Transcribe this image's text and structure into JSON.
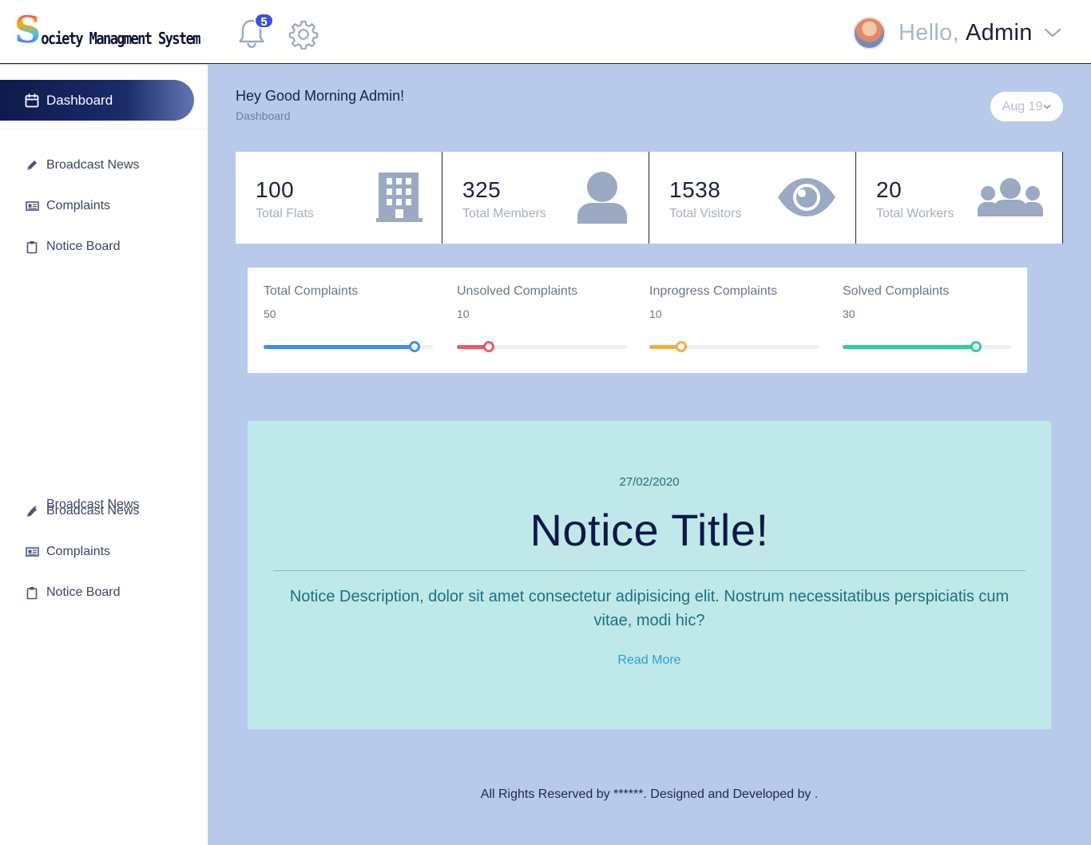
{
  "brand": {
    "initial": "S",
    "rest": "ociety Managment System"
  },
  "header": {
    "notification_count": "5",
    "greeting_prefix": "Hello,",
    "user_name": "Admin"
  },
  "sidebar": {
    "dashboard_label": "Dashboard",
    "group1": [
      {
        "label": "Broadcast News",
        "icon": "pencil-icon"
      },
      {
        "label": "Complaints",
        "icon": "newspaper-icon"
      },
      {
        "label": "Notice Board",
        "icon": "clipboard-icon"
      }
    ],
    "group2": [
      {
        "label": "Broadcast News",
        "icon": "pencil-icon"
      },
      {
        "label": "Complaints",
        "icon": "newspaper-icon"
      },
      {
        "label": "Notice Board",
        "icon": "clipboard-icon"
      }
    ]
  },
  "page": {
    "greeting": "Hey Good Morning Admin!",
    "breadcrumb": "Dashboard",
    "date_filter": "Aug 19"
  },
  "stats": [
    {
      "value": "100",
      "label": "Total Flats",
      "icon": "building-icon"
    },
    {
      "value": "325",
      "label": "Total Members",
      "icon": "user-icon"
    },
    {
      "value": "1538",
      "label": "Total Visitors",
      "icon": "eye-icon"
    },
    {
      "value": "20",
      "label": "Total Workers",
      "icon": "users-icon"
    }
  ],
  "complaints": [
    {
      "title": "Total Complaints",
      "value": "50",
      "progress": 0.89,
      "color": "#3d8ef0"
    },
    {
      "title": "Unsolved Complaints",
      "value": "10",
      "progress": 0.19,
      "color": "#f05667"
    },
    {
      "title": "Inprogress Complaints",
      "value": "10",
      "progress": 0.19,
      "color": "#f6ac3a"
    },
    {
      "title": "Solved Complaints",
      "value": "30",
      "progress": 0.79,
      "color": "#2bcfa2"
    }
  ],
  "notice": {
    "date": "27/02/2020",
    "title": "Notice Title!",
    "description": "Notice Description, dolor sit amet consectetur adipisicing elit. Nostrum necessitatibus perspiciatis cum vitae, modi hic?",
    "read_more": "Read More"
  },
  "footer": {
    "text": "All Rights Reserved by ******. Designed and Developed by ."
  }
}
